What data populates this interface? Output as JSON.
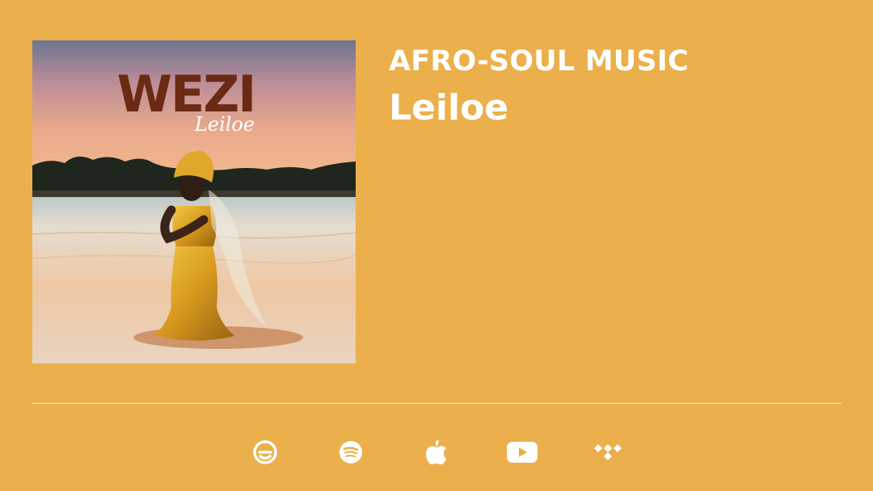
{
  "album": {
    "cover_title": "WEZI",
    "cover_subtitle": "Leiloe"
  },
  "info": {
    "genre": "AFRO-SOUL MUSIC",
    "artist": "Leiloe"
  },
  "platforms": [
    {
      "name": "e-music-icon"
    },
    {
      "name": "spotify-icon"
    },
    {
      "name": "apple-music-icon"
    },
    {
      "name": "youtube-icon"
    },
    {
      "name": "tidal-icon"
    }
  ],
  "colors": {
    "background": "#ebaf4b",
    "text": "#ffffff",
    "cover_title": "#6b2a14"
  }
}
